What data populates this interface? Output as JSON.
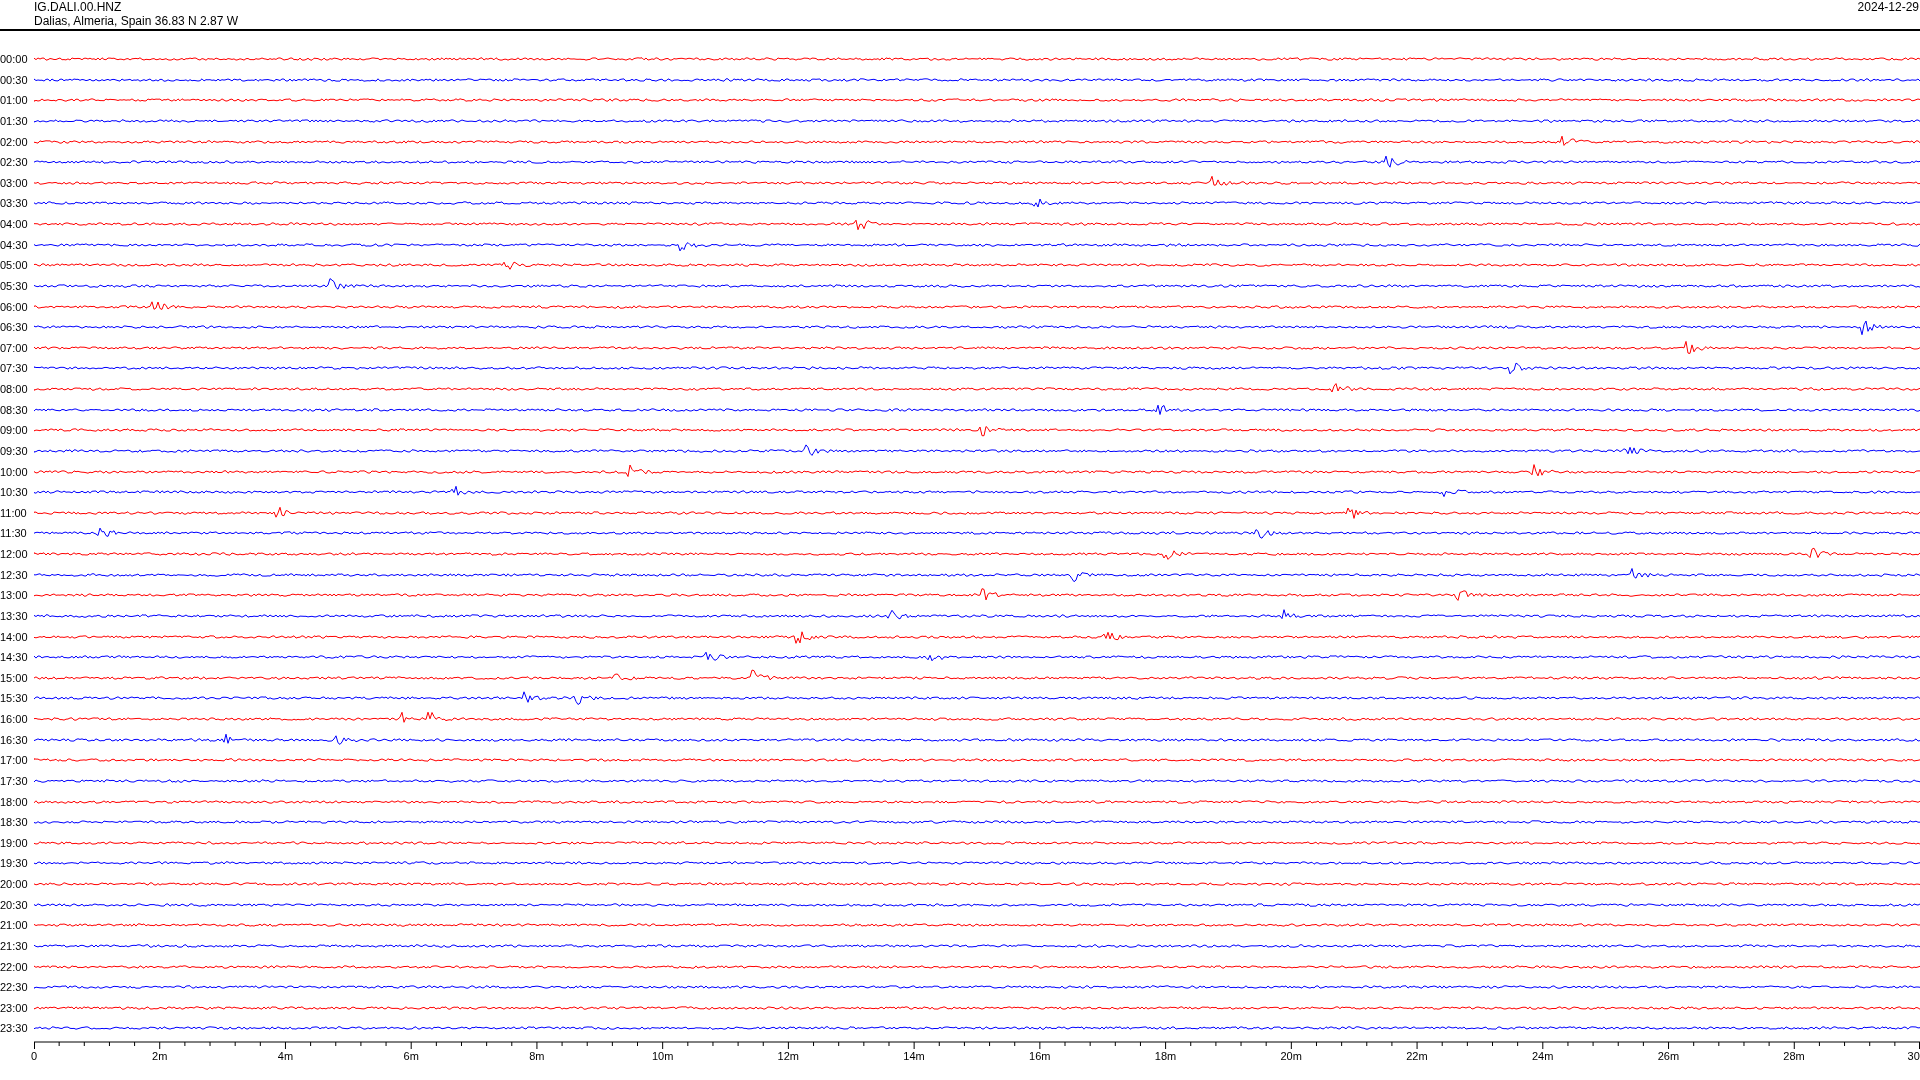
{
  "header": {
    "station": "IG.DALI.00.HNZ",
    "location": "Dalias, Almeria, Spain  36.83 N 2.87 W",
    "date": "2024-12-29"
  },
  "traces": [
    {
      "label": "00:00",
      "color": "#ff0000"
    },
    {
      "label": "00:30",
      "color": "#0000ff"
    },
    {
      "label": "01:00",
      "color": "#ff0000"
    },
    {
      "label": "01:30",
      "color": "#0000ff"
    },
    {
      "label": "02:00",
      "color": "#ff0000"
    },
    {
      "label": "02:30",
      "color": "#0000ff"
    },
    {
      "label": "03:00",
      "color": "#ff0000"
    },
    {
      "label": "03:30",
      "color": "#0000ff"
    },
    {
      "label": "04:00",
      "color": "#ff0000"
    },
    {
      "label": "04:30",
      "color": "#0000ff"
    },
    {
      "label": "05:00",
      "color": "#ff0000"
    },
    {
      "label": "05:30",
      "color": "#0000ff"
    },
    {
      "label": "06:00",
      "color": "#ff0000"
    },
    {
      "label": "06:30",
      "color": "#0000ff"
    },
    {
      "label": "07:00",
      "color": "#ff0000"
    },
    {
      "label": "07:30",
      "color": "#0000ff"
    },
    {
      "label": "08:00",
      "color": "#ff0000"
    },
    {
      "label": "08:30",
      "color": "#0000ff"
    },
    {
      "label": "09:00",
      "color": "#ff0000"
    },
    {
      "label": "09:30",
      "color": "#0000ff"
    },
    {
      "label": "10:00",
      "color": "#ff0000"
    },
    {
      "label": "10:30",
      "color": "#0000ff"
    },
    {
      "label": "11:00",
      "color": "#ff0000"
    },
    {
      "label": "11:30",
      "color": "#0000ff"
    },
    {
      "label": "12:00",
      "color": "#ff0000"
    },
    {
      "label": "12:30",
      "color": "#0000ff"
    },
    {
      "label": "13:00",
      "color": "#ff0000"
    },
    {
      "label": "13:30",
      "color": "#0000ff"
    },
    {
      "label": "14:00",
      "color": "#ff0000"
    },
    {
      "label": "14:30",
      "color": "#0000ff"
    },
    {
      "label": "15:00",
      "color": "#ff0000"
    },
    {
      "label": "15:30",
      "color": "#0000ff"
    },
    {
      "label": "16:00",
      "color": "#ff0000"
    },
    {
      "label": "16:30",
      "color": "#0000ff"
    },
    {
      "label": "17:00",
      "color": "#ff0000"
    },
    {
      "label": "17:30",
      "color": "#0000ff"
    },
    {
      "label": "18:00",
      "color": "#ff0000"
    },
    {
      "label": "18:30",
      "color": "#0000ff"
    },
    {
      "label": "19:00",
      "color": "#ff0000"
    },
    {
      "label": "19:30",
      "color": "#0000ff"
    },
    {
      "label": "20:00",
      "color": "#ff0000"
    },
    {
      "label": "20:30",
      "color": "#0000ff"
    },
    {
      "label": "21:00",
      "color": "#ff0000"
    },
    {
      "label": "21:30",
      "color": "#0000ff"
    },
    {
      "label": "22:00",
      "color": "#ff0000"
    },
    {
      "label": "22:30",
      "color": "#0000ff"
    },
    {
      "label": "23:00",
      "color": "#ff0000"
    },
    {
      "label": "23:30",
      "color": "#0000ff"
    }
  ],
  "x_axis": {
    "ticks": [
      "0",
      "2m",
      "4m",
      "6m",
      "8m",
      "10m",
      "12m",
      "14m",
      "16m",
      "18m",
      "20m",
      "22m",
      "24m",
      "26m",
      "28m",
      "30"
    ]
  }
}
